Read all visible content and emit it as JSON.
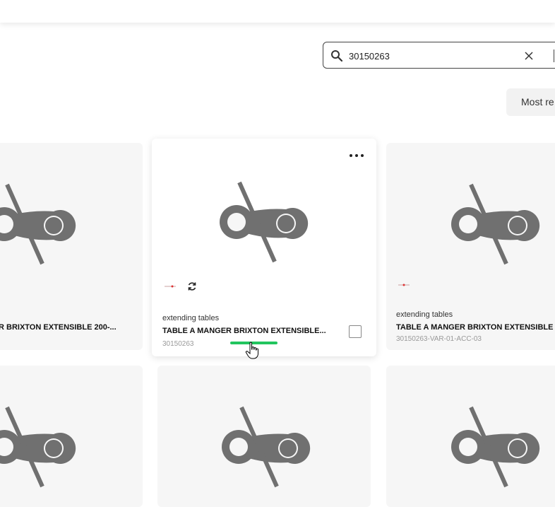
{
  "search": {
    "value": "30150263"
  },
  "sort": {
    "label": "Most re"
  },
  "cards": [
    {
      "title": "R BRIXTON EXTENSIBLE 200-..."
    },
    {
      "category": "extending tables",
      "title": "TABLE A MANGER BRIXTON EXTENSIBLE...",
      "sku": "30150263"
    },
    {
      "category": "extending tables",
      "title": "TABLE A MANGER BRIXTON EXTENSIBLE 20",
      "sku": "30150263-VAR-01-ACC-03"
    }
  ],
  "icons": {
    "search": "search-icon",
    "clear": "close-icon",
    "more": "more-horizontal-icon",
    "image": "image-unavailable-icon",
    "sync": "sync-icon"
  },
  "colors": {
    "highlight": "#22c55e",
    "card_bg": "#f6f6f6",
    "icon_gray": "#707070"
  }
}
